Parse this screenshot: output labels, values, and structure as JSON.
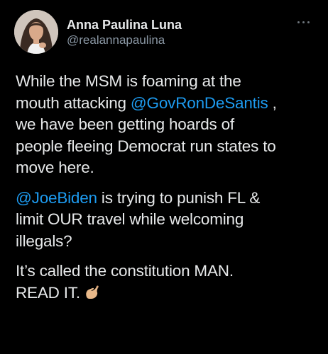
{
  "tweet": {
    "display_name": "Anna Paulina Luna",
    "handle": "@realannapaulina",
    "more_icon": "ellipsis-icon",
    "avatar_icon": "profile-photo",
    "paragraphs": [
      {
        "line1": "While the MSM is foaming at the",
        "line2a": "mouth attacking ",
        "mention": "@GovRonDeSantis",
        "line2b": " ,",
        "line3": "we have been getting hoards of",
        "line4": "people fleeing Democrat run states to",
        "line5": "move here."
      },
      {
        "mention": "@JoeBiden",
        "line1b": " is trying to punish FL &",
        "line2": "limit OUR travel while welcoming",
        "line3": "illegals?"
      },
      {
        "line1": "It’s called the constitution MAN.",
        "line2": "READ IT.",
        "emoji_icon": "pinching-hand-emoji"
      }
    ]
  },
  "colors": {
    "background": "#000000",
    "text": "#e7e9ea",
    "secondary": "#8b98a5",
    "mention": "#1d9bf0"
  }
}
